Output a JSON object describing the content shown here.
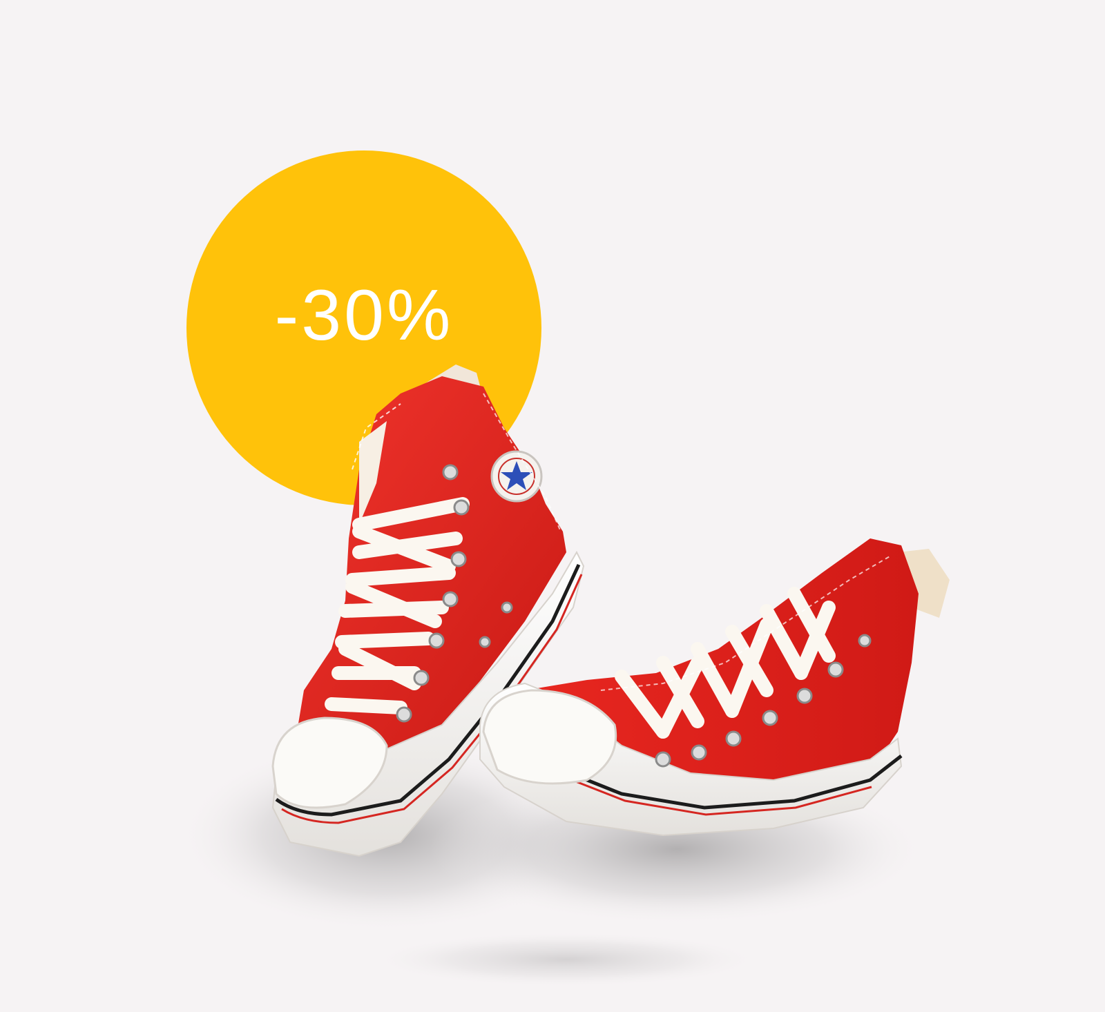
{
  "badge": {
    "label": "-30%",
    "color": "#ffc20a"
  },
  "product": {
    "icon": "red-high-top-sneakers-icon",
    "color": "#e5221e"
  },
  "background_color": "#f6f3f4"
}
